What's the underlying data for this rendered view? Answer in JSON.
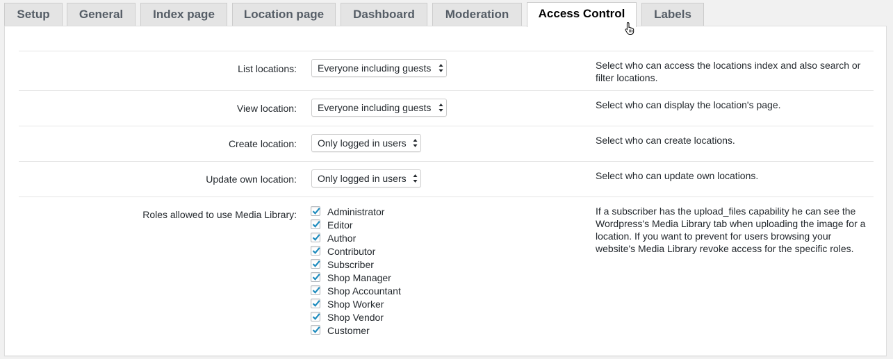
{
  "tabs": [
    {
      "label": "Setup",
      "active": false
    },
    {
      "label": "General",
      "active": false
    },
    {
      "label": "Index page",
      "active": false
    },
    {
      "label": "Location page",
      "active": false
    },
    {
      "label": "Dashboard",
      "active": false
    },
    {
      "label": "Moderation",
      "active": false
    },
    {
      "label": "Access Control",
      "active": true
    },
    {
      "label": "Labels",
      "active": false
    }
  ],
  "settings": {
    "list_locations": {
      "label": "List locations:",
      "value": "Everyone including guests",
      "description": "Select who can access the locations index and also search or filter locations."
    },
    "view_location": {
      "label": "View location:",
      "value": "Everyone including guests",
      "description": "Select who can display the location's page."
    },
    "create_location": {
      "label": "Create location:",
      "value": "Only logged in users",
      "description": "Select who can create locations."
    },
    "update_own_location": {
      "label": "Update own location:",
      "value": "Only logged in users",
      "description": "Select who can update own locations."
    },
    "media_library": {
      "label": "Roles allowed to use Media Library:",
      "description": "If a subscriber has the upload_files capability he can see the Wordpress's Media Library tab when uploading the image for a location. If you want to prevent for users browsing your website's Media Library revoke access for the specific roles.",
      "roles": [
        {
          "label": "Administrator",
          "checked": true
        },
        {
          "label": "Editor",
          "checked": true
        },
        {
          "label": "Author",
          "checked": true
        },
        {
          "label": "Contributor",
          "checked": true
        },
        {
          "label": "Subscriber",
          "checked": true
        },
        {
          "label": "Shop Manager",
          "checked": true
        },
        {
          "label": "Shop Accountant",
          "checked": true
        },
        {
          "label": "Shop Worker",
          "checked": true
        },
        {
          "label": "Shop Vendor",
          "checked": true
        },
        {
          "label": "Customer",
          "checked": true
        }
      ]
    }
  },
  "colors": {
    "checkmark": "#1e8cbe",
    "active_tab_bg": "#ffffff",
    "inactive_tab_bg": "#e4e4e4"
  },
  "icons": {
    "select_arrows": "updown-arrows-icon",
    "checkbox": "checkmark-icon",
    "cursor": "hand-pointer-icon"
  }
}
